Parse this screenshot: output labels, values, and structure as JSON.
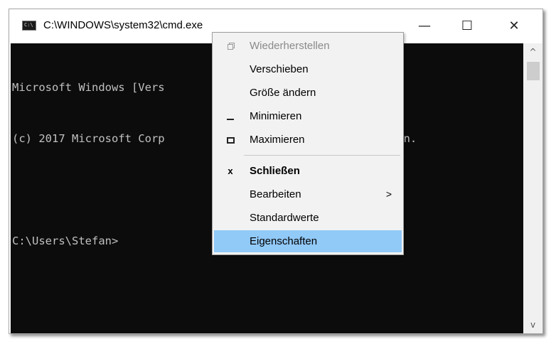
{
  "window": {
    "title": "C:\\WINDOWS\\system32\\cmd.exe",
    "app_icon_text": "C:\\",
    "controls": {
      "minimize": "—",
      "maximize": "☐",
      "close": "✕"
    }
  },
  "console": {
    "lines": [
      "Microsoft Windows [Vers",
      "(c) 2017 Microsoft Corp                           orbehalten.",
      "",
      "C:\\Users\\Stefan>"
    ]
  },
  "scrollbar": {
    "up_arrow": "^",
    "down_arrow": "v"
  },
  "context_menu": {
    "items": [
      {
        "label": "Wiederherstellen",
        "icon": "restore-icon",
        "state": "disabled"
      },
      {
        "label": "Verschieben",
        "icon": "",
        "state": "normal"
      },
      {
        "label": "Größe ändern",
        "icon": "",
        "state": "normal"
      },
      {
        "label": "Minimieren",
        "icon": "minimize-icon",
        "state": "normal"
      },
      {
        "label": "Maximieren",
        "icon": "maximize-icon",
        "state": "normal"
      },
      {
        "label": "Schließen",
        "icon": "close-icon",
        "icon_glyph": "x",
        "state": "bold"
      },
      {
        "label": "Bearbeiten",
        "icon": "",
        "submenu_glyph": ">",
        "state": "normal"
      },
      {
        "label": "Standardwerte",
        "icon": "",
        "state": "normal"
      },
      {
        "label": "Eigenschaften",
        "icon": "",
        "state": "selected"
      }
    ],
    "colors": {
      "selected_bg": "#91c9f7",
      "menu_bg": "#f2f2f2",
      "disabled_text": "#8a8a8a"
    }
  }
}
